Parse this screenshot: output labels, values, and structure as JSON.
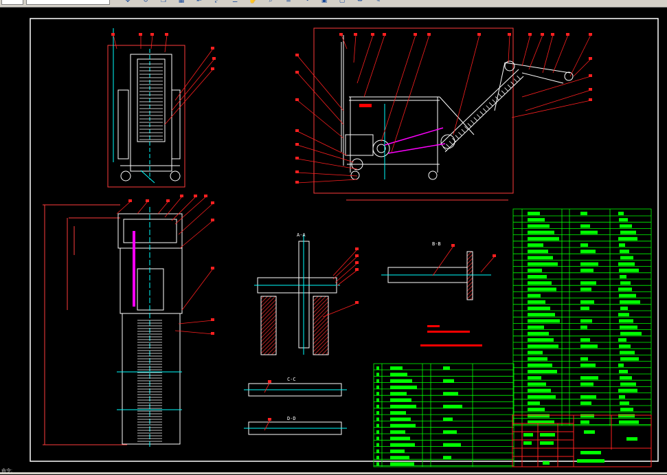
{
  "toolbar": {
    "layer_field": "",
    "buttons": [
      "move-icon",
      "rotate-icon",
      "copy-icon",
      "array-icon",
      "align-icon",
      "scale-icon",
      "properties-icon",
      "pan-icon",
      "zoom-icon",
      "match-icon",
      "redo-icon",
      "view-icon",
      "window-icon",
      "measure-icon",
      "erase-icon"
    ]
  },
  "drawing": {
    "section_labels": [
      "A-A",
      "B-B",
      "C-C",
      "D-D"
    ]
  },
  "colors": {
    "background": "#000000",
    "frame": "#ffffff",
    "outline": "#ffffff",
    "leader": "#ff0000",
    "centerline": "#00ffff",
    "table_grid": "#00ff00",
    "hatch": "#b22222",
    "belt_path": "#ff00ff",
    "title_block": "#ff0000"
  },
  "status": {
    "text": "命令:"
  }
}
